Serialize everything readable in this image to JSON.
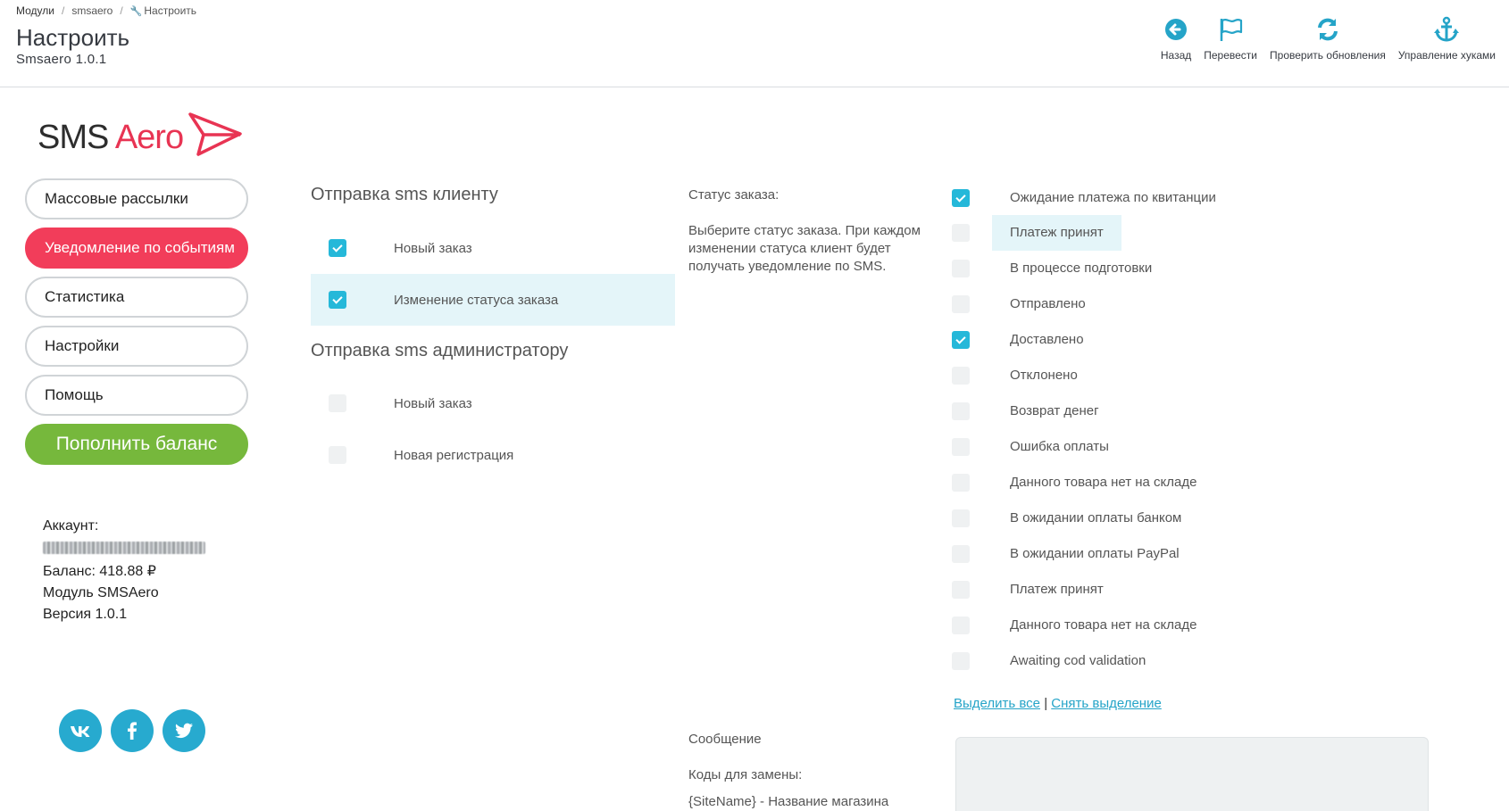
{
  "breadcrumb": {
    "items": [
      "Модули",
      "smsaero",
      "Настроить"
    ]
  },
  "page": {
    "title": "Настроить",
    "subtitle": "Smsaero 1.0.1"
  },
  "toolbar": {
    "back": "Назад",
    "translate": "Перевести",
    "check_updates": "Проверить обновления",
    "manage_hooks": "Управление хуками"
  },
  "logo": {
    "sms": "SMS",
    "aero": "Aero"
  },
  "sidebar": {
    "items": [
      {
        "label": "Массовые рассылки",
        "active": false
      },
      {
        "label": "Уведомление по событиям",
        "active": true
      },
      {
        "label": "Статистика",
        "active": false
      },
      {
        "label": "Настройки",
        "active": false
      },
      {
        "label": "Помощь",
        "active": false
      }
    ],
    "topup": "Пополнить баланс"
  },
  "account": {
    "label": "Аккаунт:",
    "balance": "Баланс: 418.88 ₽",
    "module": "Модуль SMSAero",
    "version": "Версия 1.0.1"
  },
  "socials": [
    "vk-icon",
    "facebook-icon",
    "twitter-icon"
  ],
  "client": {
    "title": "Отправка sms клиенту",
    "options": [
      {
        "label": "Новый заказ",
        "checked": true
      },
      {
        "label": "Изменение статуса заказа",
        "checked": true
      }
    ]
  },
  "admin": {
    "title": "Отправка sms администратору",
    "options": [
      {
        "label": "Новый заказ",
        "checked": false
      },
      {
        "label": "Новая регистрация",
        "checked": false
      }
    ]
  },
  "status": {
    "label": "Статус заказа:",
    "help": "Выберите статус заказа. При каждом изменении статуса клиент будет получать уведомление по SMS.",
    "items": [
      {
        "label": "Ожидание платежа по квитанции",
        "checked": true
      },
      {
        "label": "Платеж принят",
        "checked": false
      },
      {
        "label": "В процессе подготовки",
        "checked": false
      },
      {
        "label": "Отправлено",
        "checked": false
      },
      {
        "label": "Доставлено",
        "checked": true
      },
      {
        "label": "Отклонено",
        "checked": false
      },
      {
        "label": "Возврат денег",
        "checked": false
      },
      {
        "label": "Ошибка оплаты",
        "checked": false
      },
      {
        "label": "Данного товара нет на складе",
        "checked": false
      },
      {
        "label": "В ожидании оплаты банком",
        "checked": false
      },
      {
        "label": "В ожидании оплаты PayPal",
        "checked": false
      },
      {
        "label": "Платеж принят",
        "checked": false
      },
      {
        "label": "Данного товара нет на складе",
        "checked": false
      },
      {
        "label": "Awaiting cod validation",
        "checked": false
      }
    ],
    "select_all": "Выделить все",
    "divider": "|",
    "deselect": "Снять выделение"
  },
  "message": {
    "label": "Сообщение",
    "codes_label": "Коды для замены:",
    "code_sitename": "{SiteName} - Название магазина"
  },
  "colors": {
    "accent": "#25b8d9",
    "active_red": "#f23d5a",
    "green": "#76b83c",
    "social": "#27aacf"
  }
}
